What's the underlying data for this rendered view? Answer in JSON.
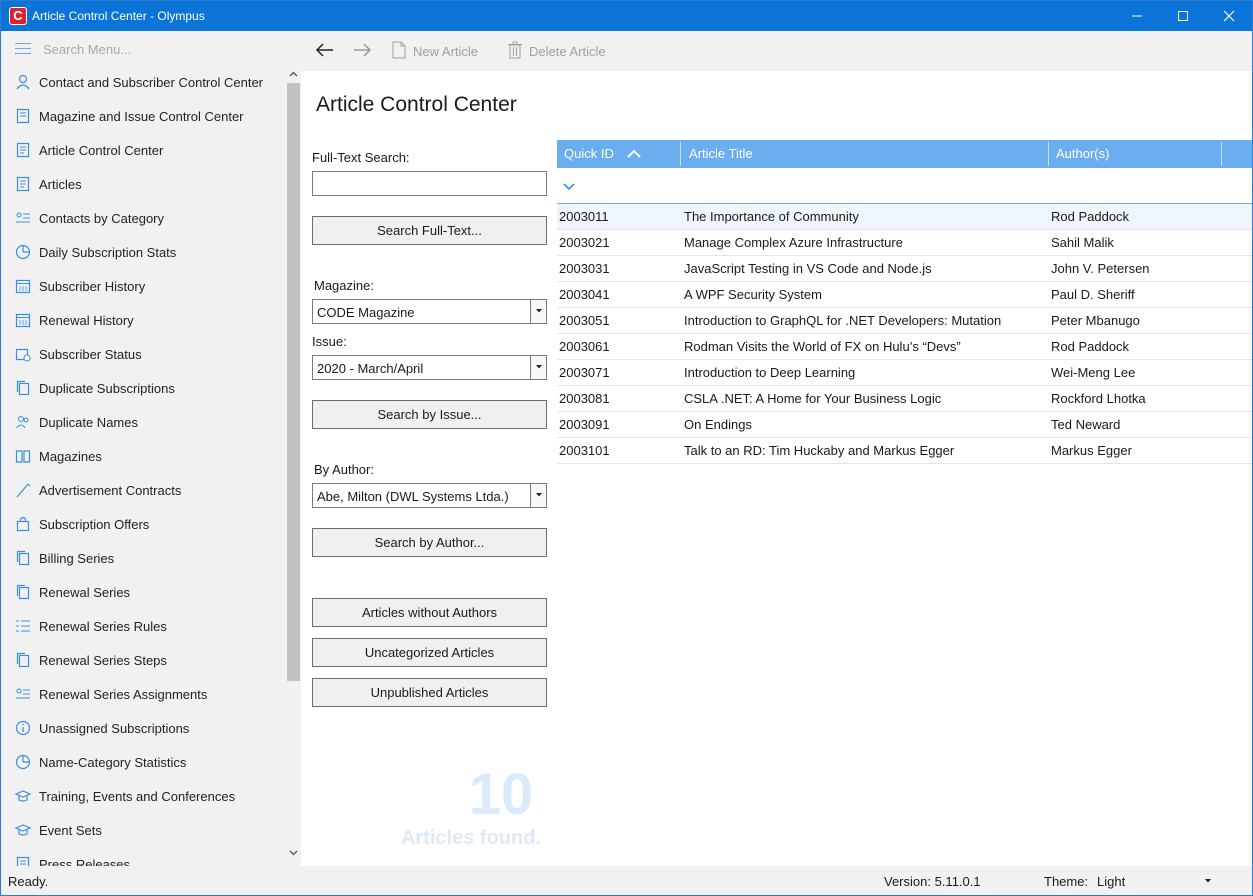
{
  "window": {
    "app_icon_letter": "C",
    "title": "Article Control Center - Olympus"
  },
  "sidebar": {
    "search_placeholder": "Search Menu...",
    "items": [
      {
        "label": "Contact and Subscriber Control Center",
        "icon": "person-icon"
      },
      {
        "label": "Magazine and Issue Control Center",
        "icon": "magazine-icon"
      },
      {
        "label": "Article Control Center",
        "icon": "article-icon"
      },
      {
        "label": "Articles",
        "icon": "article-icon"
      },
      {
        "label": "Contacts by Category",
        "icon": "contacts-list-icon"
      },
      {
        "label": "Daily Subscription Stats",
        "icon": "pie-chart-icon"
      },
      {
        "label": "Subscriber History",
        "icon": "calendar-icon"
      },
      {
        "label": "Renewal History",
        "icon": "calendar-icon"
      },
      {
        "label": "Subscriber Status",
        "icon": "status-icon"
      },
      {
        "label": "Duplicate Subscriptions",
        "icon": "copy-icon"
      },
      {
        "label": "Duplicate Names",
        "icon": "people-icon"
      },
      {
        "label": "Magazines",
        "icon": "book-icon"
      },
      {
        "label": "Advertisement Contracts",
        "icon": "pen-icon"
      },
      {
        "label": "Subscription Offers",
        "icon": "bag-icon"
      },
      {
        "label": "Billing Series",
        "icon": "copy-icon"
      },
      {
        "label": "Renewal Series",
        "icon": "copy-icon"
      },
      {
        "label": "Renewal Series Rules",
        "icon": "rules-list-icon"
      },
      {
        "label": "Renewal Series Steps",
        "icon": "copy-icon"
      },
      {
        "label": "Renewal Series Assignments",
        "icon": "contacts-list-icon"
      },
      {
        "label": "Unassigned Subscriptions",
        "icon": "info-icon"
      },
      {
        "label": "Name-Category Statistics",
        "icon": "pie-chart-icon"
      },
      {
        "label": "Training, Events and Conferences",
        "icon": "graduation-cap-icon"
      },
      {
        "label": "Event Sets",
        "icon": "graduation-cap-icon"
      },
      {
        "label": "Press Releases",
        "icon": "article-icon"
      }
    ]
  },
  "toolbar": {
    "new_article_label": "New Article",
    "delete_article_label": "Delete Article"
  },
  "main": {
    "page_title": "Article Control Center",
    "full_text_label": "Full-Text Search:",
    "full_text_value": "",
    "search_full_text_button": "Search Full-Text...",
    "magazine_label": "Magazine:",
    "magazine_value": "CODE Magazine",
    "issue_label": "Issue:",
    "issue_value": "2020 - March/April",
    "search_issue_button": "Search by Issue...",
    "author_label": "By Author:",
    "author_value": "Abe, Milton (DWL Systems Ltda.)",
    "search_author_button": "Search by Author...",
    "articles_without_authors_button": "Articles without Authors",
    "uncategorized_button": "Uncategorized Articles",
    "unpublished_button": "Unpublished Articles",
    "result_count": "10",
    "result_label": "Articles found."
  },
  "grid": {
    "columns": [
      "Quick ID",
      "Article Title",
      "Author(s)"
    ],
    "sort_column": "Quick ID",
    "sort_direction": "ascending",
    "rows": [
      {
        "id": "2003011",
        "title": "The Importance of Community",
        "author": "Rod Paddock"
      },
      {
        "id": "2003021",
        "title": "Manage Complex Azure Infrastructure",
        "author": "Sahil Malik"
      },
      {
        "id": "2003031",
        "title": "JavaScript Testing in VS Code and Node.js",
        "author": "John V. Petersen"
      },
      {
        "id": "2003041",
        "title": "A WPF Security System",
        "author": "Paul D. Sheriff"
      },
      {
        "id": "2003051",
        "title": "Introduction to GraphQL for .NET Developers: Mutation",
        "author": "Peter Mbanugo"
      },
      {
        "id": "2003061",
        "title": "Rodman Visits the World of FX on Hulu’s “Devs”",
        "author": "Rod Paddock"
      },
      {
        "id": "2003071",
        "title": "Introduction to Deep Learning",
        "author": "Wei-Meng Lee"
      },
      {
        "id": "2003081",
        "title": "CSLA .NET: A Home for Your Business Logic",
        "author": "Rockford Lhotka"
      },
      {
        "id": "2003091",
        "title": "On Endings",
        "author": "Ted Neward"
      },
      {
        "id": "2003101",
        "title": "Talk to an RD: Tim Huckaby and Markus Egger",
        "author": "Markus Egger"
      }
    ]
  },
  "statusbar": {
    "status": "Ready.",
    "version": "Version: 5.11.0.1",
    "theme_label": "Theme:",
    "theme_value": "Light"
  },
  "colors": {
    "titlebar": "#0a74d8",
    "grid_header": "#6aaef0",
    "accent": "#4a90d9",
    "count_watermark": "#dbeafa"
  }
}
